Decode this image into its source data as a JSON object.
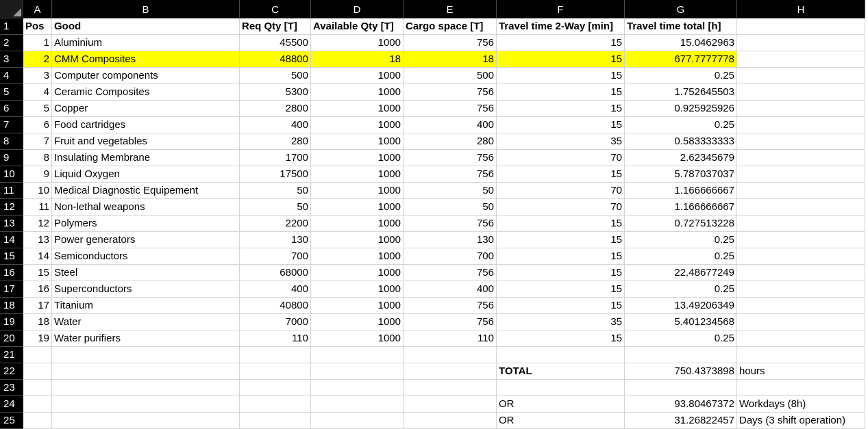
{
  "columns": [
    "A",
    "B",
    "C",
    "D",
    "E",
    "F",
    "G",
    "H"
  ],
  "row_numbers": [
    "1",
    "2",
    "3",
    "4",
    "5",
    "6",
    "7",
    "8",
    "9",
    "10",
    "11",
    "12",
    "13",
    "14",
    "15",
    "16",
    "17",
    "18",
    "19",
    "20",
    "21",
    "22",
    "23",
    "24",
    "25"
  ],
  "header": {
    "pos": "Pos",
    "good": "Good",
    "req_qty": "Req Qty [T]",
    "available_qty": "Available Qty [T]",
    "cargo_space": "Cargo space [T]",
    "travel_time_2way": "Travel time 2-Way [min]",
    "travel_time_total": "Travel time total [h]"
  },
  "rows": [
    {
      "pos": "1",
      "good": "Aluminium",
      "req": "45500",
      "avail": "1000",
      "cargo": "756",
      "t2": "15",
      "total": "15.0462963"
    },
    {
      "pos": "2",
      "good": "CMM Composites",
      "req": "48800",
      "avail": "18",
      "cargo": "18",
      "t2": "15",
      "total": "677.7777778",
      "highlight": "#ffff00"
    },
    {
      "pos": "3",
      "good": "Computer components",
      "req": "500",
      "avail": "1000",
      "cargo": "500",
      "t2": "15",
      "total": "0.25"
    },
    {
      "pos": "4",
      "good": "Ceramic Composites",
      "req": "5300",
      "avail": "1000",
      "cargo": "756",
      "t2": "15",
      "total": "1.752645503"
    },
    {
      "pos": "5",
      "good": "Copper",
      "req": "2800",
      "avail": "1000",
      "cargo": "756",
      "t2": "15",
      "total": "0.925925926"
    },
    {
      "pos": "6",
      "good": "Food cartridges",
      "req": "400",
      "avail": "1000",
      "cargo": "400",
      "t2": "15",
      "total": "0.25"
    },
    {
      "pos": "7",
      "good": "Fruit and vegetables",
      "req": "280",
      "avail": "1000",
      "cargo": "280",
      "t2": "35",
      "total": "0.583333333"
    },
    {
      "pos": "8",
      "good": "Insulating Membrane",
      "req": "1700",
      "avail": "1000",
      "cargo": "756",
      "t2": "70",
      "total": "2.62345679"
    },
    {
      "pos": "9",
      "good": "Liquid Oxygen",
      "req": "17500",
      "avail": "1000",
      "cargo": "756",
      "t2": "15",
      "total": "5.787037037"
    },
    {
      "pos": "10",
      "good": "Medical Diagnostic Equipement",
      "req": "50",
      "avail": "1000",
      "cargo": "50",
      "t2": "70",
      "total": "1.166666667"
    },
    {
      "pos": "11",
      "good": "Non-lethal weapons",
      "req": "50",
      "avail": "1000",
      "cargo": "50",
      "t2": "70",
      "total": "1.166666667"
    },
    {
      "pos": "12",
      "good": "Polymers",
      "req": "2200",
      "avail": "1000",
      "cargo": "756",
      "t2": "15",
      "total": "0.727513228"
    },
    {
      "pos": "13",
      "good": "Power generators",
      "req": "130",
      "avail": "1000",
      "cargo": "130",
      "t2": "15",
      "total": "0.25"
    },
    {
      "pos": "14",
      "good": "Semiconductors",
      "req": "700",
      "avail": "1000",
      "cargo": "700",
      "t2": "15",
      "total": "0.25"
    },
    {
      "pos": "15",
      "good": "Steel",
      "req": "68000",
      "avail": "1000",
      "cargo": "756",
      "t2": "15",
      "total": "22.48677249"
    },
    {
      "pos": "16",
      "good": "Superconductors",
      "req": "400",
      "avail": "1000",
      "cargo": "400",
      "t2": "15",
      "total": "0.25"
    },
    {
      "pos": "17",
      "good": "Titanium",
      "req": "40800",
      "avail": "1000",
      "cargo": "756",
      "t2": "15",
      "total": "13.49206349"
    },
    {
      "pos": "18",
      "good": "Water",
      "req": "7000",
      "avail": "1000",
      "cargo": "756",
      "t2": "35",
      "total": "5.401234568"
    },
    {
      "pos": "19",
      "good": "Water purifiers",
      "req": "110",
      "avail": "1000",
      "cargo": "110",
      "t2": "15",
      "total": "0.25"
    }
  ],
  "summary": {
    "total_label": "TOTAL",
    "total_value": "750.4373898",
    "total_unit": "hours",
    "or1_label": "OR",
    "or1_value": "93.80467372",
    "or1_unit": "Workdays (8h)",
    "or2_label": "OR",
    "or2_value": "31.26822457",
    "or2_unit": "Days (3 shift operation)"
  }
}
